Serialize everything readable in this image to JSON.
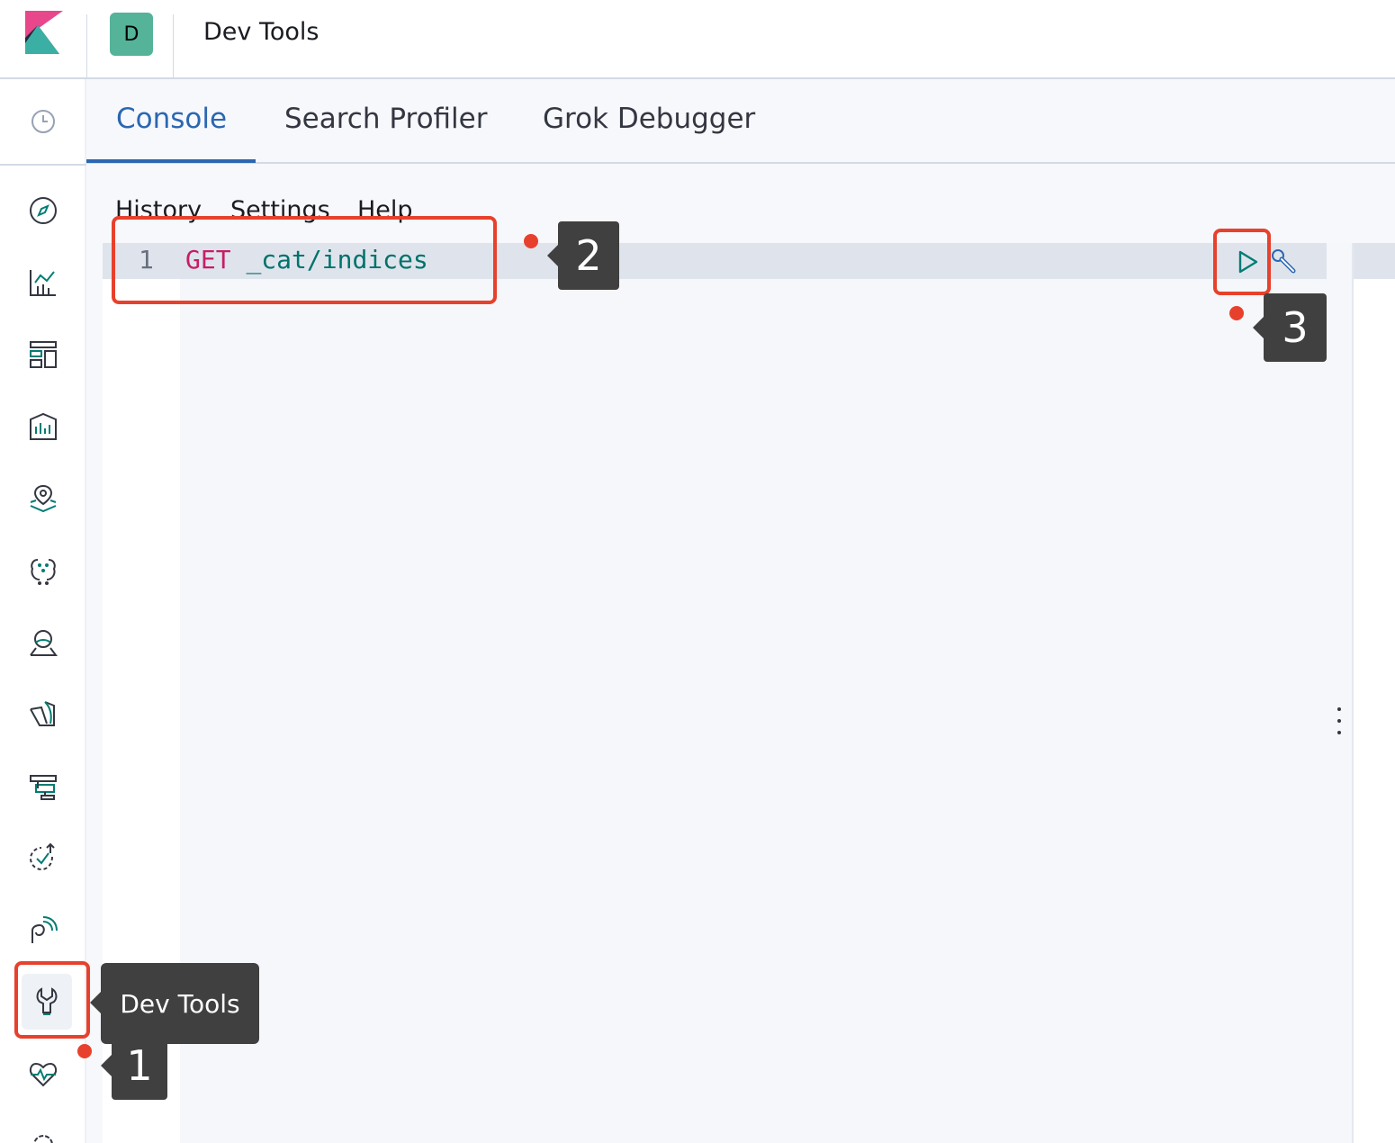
{
  "header": {
    "space_initial": "D",
    "app_title": "Dev Tools"
  },
  "sidenav": {
    "items": [
      {
        "name": "discover",
        "icon": "compass-icon"
      },
      {
        "name": "visualize",
        "icon": "chart-icon"
      },
      {
        "name": "dashboard",
        "icon": "dashboard-icon"
      },
      {
        "name": "canvas",
        "icon": "canvas-icon"
      },
      {
        "name": "maps",
        "icon": "map-pin-icon"
      },
      {
        "name": "ml",
        "icon": "machine-learning-icon"
      },
      {
        "name": "siem",
        "icon": "security-icon"
      },
      {
        "name": "logs",
        "icon": "logs-icon"
      },
      {
        "name": "apm",
        "icon": "apm-icon"
      },
      {
        "name": "uptime",
        "icon": "uptime-icon"
      },
      {
        "name": "graph",
        "icon": "graph-icon"
      },
      {
        "name": "dev-tools",
        "icon": "wrench-icon",
        "active": true
      },
      {
        "name": "monitoring",
        "icon": "heartbeat-icon"
      }
    ],
    "tooltip": "Dev Tools"
  },
  "tabs": [
    {
      "label": "Console",
      "active": true
    },
    {
      "label": "Search Profiler"
    },
    {
      "label": "Grok Debugger"
    }
  ],
  "console_menu": {
    "history": "History",
    "settings": "Settings",
    "help": "Help"
  },
  "editor": {
    "line_number": "1",
    "method": "GET",
    "path": "_cat/indices"
  },
  "annotations": {
    "step1": "1",
    "step2": "2",
    "step3": "3"
  },
  "colors": {
    "accent": "#2b67b1",
    "method": "#c61e66",
    "path": "#00726b",
    "annotation": "#e7412d",
    "callout_bg": "#404040"
  }
}
